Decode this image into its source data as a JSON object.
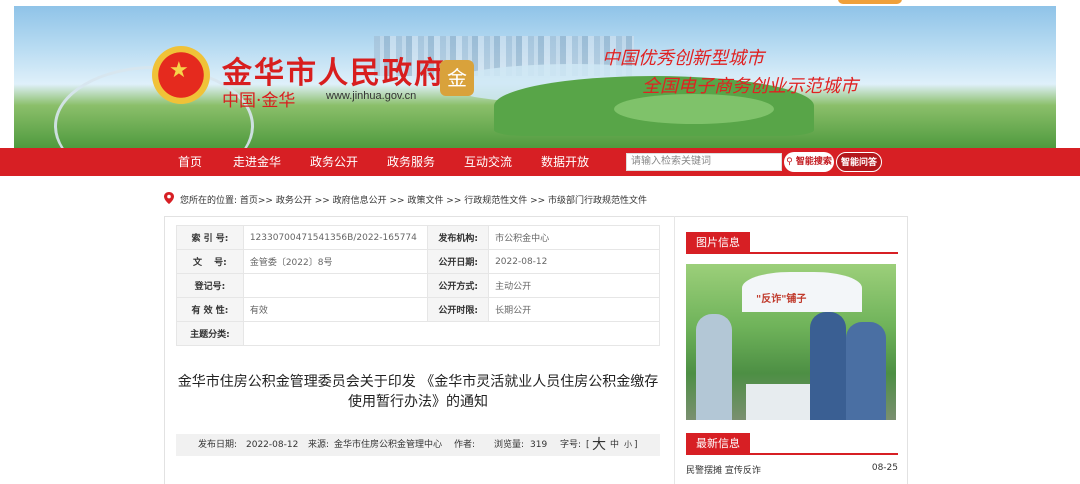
{
  "header": {
    "title": "金华市人民政府",
    "subtitle": "中国·金华",
    "url": "www.jinhua.gov.cn",
    "seal_char": "金",
    "slogan_1": "中国优秀创新型城市",
    "slogan_2": "全国电子商务创业示范城市",
    "emblem_icon": "national-emblem-icon"
  },
  "nav": {
    "items": [
      "首页",
      "走进金华",
      "政务公开",
      "政务服务",
      "互动交流",
      "数据开放"
    ],
    "search_placeholder": "请输入检索关键词",
    "search_button": "智能搜索",
    "ask_button": "智能问答"
  },
  "breadcrumb": {
    "text": "您所在的位置:  首页>> 政务公开 >> 政府信息公开 >> 政策文件 >> 行政规范性文件 >> 市级部门行政规范性文件"
  },
  "meta": {
    "index_label": "索 引 号:",
    "index_value": "12330700471541356B/2022-165774",
    "org_label": "发布机构:",
    "org_value": "市公积金中心",
    "doc_label": "文　 号:",
    "doc_value": "金管委〔2022〕8号",
    "pub_date_label": "公开日期:",
    "pub_date_value": "2022-08-12",
    "reg_label": "登记号:",
    "reg_value": "",
    "pub_mode_label": "公开方式:",
    "pub_mode_value": "主动公开",
    "valid_label": "有 效 性:",
    "valid_value": "有效",
    "period_label": "公开时限:",
    "period_value": "长期公开",
    "topic_label": "主题分类:",
    "topic_value": ""
  },
  "article": {
    "title": "金华市住房公积金管理委员会关于印发 《金华市灵活就业人员住房公积金缴存使用暂行办法》的通知",
    "date_label": "发布日期:",
    "date_value": "2022-08-12",
    "source_label": "来源:",
    "source_value": "金华市住房公积金管理中心",
    "author_label": "作者:",
    "views_label": "浏览量:",
    "views_value": "319",
    "font_label": "字号:",
    "font_open": "[",
    "font_big": "大",
    "font_mid": "中",
    "font_small": "小",
    "font_close": "]"
  },
  "sidebar": {
    "photo_heading": "图片信息",
    "photo_sign": "\"反诈\"铺子",
    "latest_heading": "最新信息",
    "latest_items": [
      {
        "title": "民警摆摊 宣传反诈",
        "date": "08-25"
      }
    ]
  },
  "colors": {
    "brand_red": "#d71f24",
    "banner_green": "#58a548",
    "accent_orange": "#f0a03a"
  }
}
